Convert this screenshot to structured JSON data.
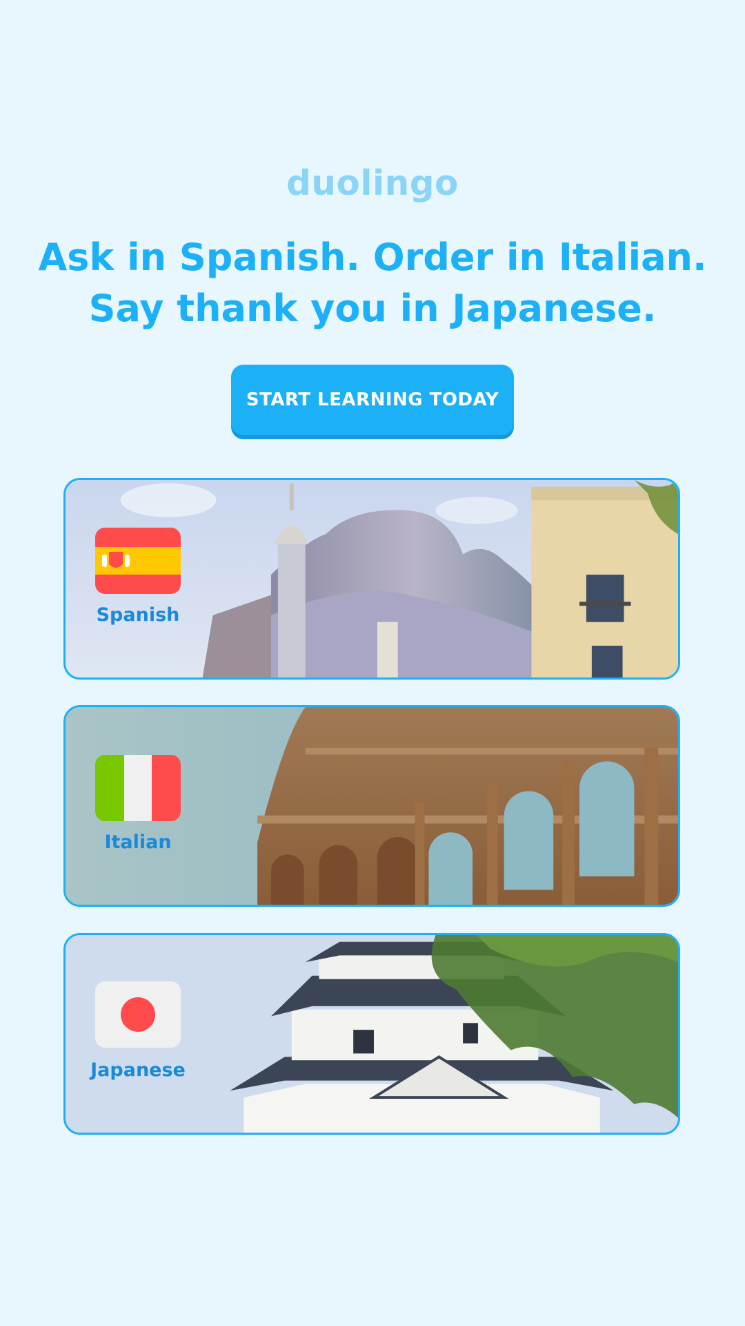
{
  "brand": {
    "logo_text": "duolingo"
  },
  "hero": {
    "headline_line1": "Ask in Spanish. Order in Italian.",
    "headline_line2": "Say thank you in Japanese.",
    "cta_label": "START LEARNING TODAY"
  },
  "languages": [
    {
      "label": "Spanish",
      "flag": "spain-flag-icon",
      "scene": "barcelona-building-photo"
    },
    {
      "label": "Italian",
      "flag": "italy-flag-icon",
      "scene": "colosseum-photo"
    },
    {
      "label": "Japanese",
      "flag": "japan-flag-icon",
      "scene": "japanese-castle-photo"
    }
  ],
  "colors": {
    "background": "#e8f6fe",
    "brand_blue": "#1cb0f6",
    "logo_blue": "#8ad4f8",
    "label_blue": "#1a8ad8"
  }
}
